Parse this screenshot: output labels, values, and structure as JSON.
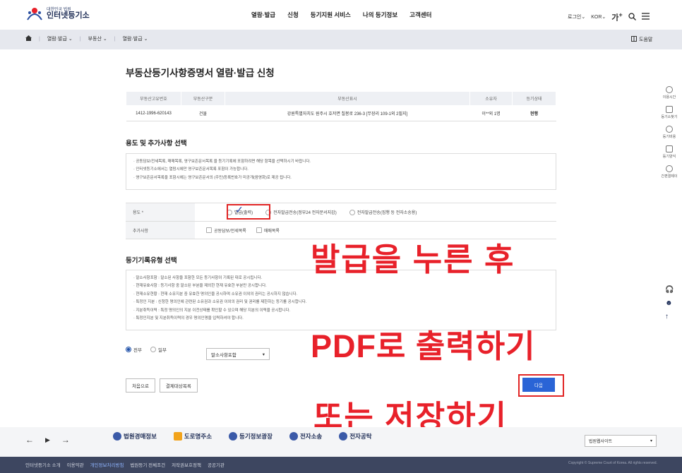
{
  "header": {
    "logo_small": "대한민국 법원",
    "logo_name": "인터넷등기소",
    "nav": [
      "열람·발급",
      "신청",
      "등기지원 서비스",
      "나의 등기정보",
      "고객센터"
    ],
    "login": "로그인",
    "lang": "KOR",
    "font_size": "가",
    "font_plus": "+"
  },
  "breadcrumb": {
    "items": [
      "열람·발급",
      "부동산",
      "열람·발급"
    ],
    "help": "도움말"
  },
  "page_title": "부동산등기사항증명서 열람·발급 신청",
  "property_table": {
    "headers": [
      "부동산고유번호",
      "부동산구분",
      "부동산표시",
      "소유자",
      "등기상태"
    ],
    "row": [
      "1412-1996-620143",
      "건물",
      "강원특별자치도 원주시 호저면 칠봉로 236-3 [무장리 109-1외 2필지]",
      "이**외 1명",
      "현행"
    ]
  },
  "usage_section": {
    "title": "용도 및 추가사항 선택",
    "notes": [
      "공동담보/전세목록, 매매목록, 영구보존문서목록 을 등기기록에 포함하려면 해당 항목을 선택하시기 바랍니다.",
      "인터넷등기소에서는 열람시에만 영구보존문서목록 포함이 가능합니다.",
      "영구보존문서목록을 포함시에는 영구보존문서의 (주민)등록번호가 미공개(음영화)로 제공 됩니다."
    ],
    "usage_label": "용도 *",
    "usage_options": [
      "발급(출력)",
      "전자발급전송(정부24 전자문서지갑)",
      "전자발급전송(집행 등 전자소송용)"
    ],
    "extra_label": "추가사항",
    "extra_options": [
      "공동담보/전세목록",
      "매매목록"
    ]
  },
  "record_section": {
    "title": "등기기록유형 선택",
    "notes": [
      "말소사항포함 : 말소된 사항을 포함한 모든 등기사항이 기록된 대로 공시됩니다.",
      "현재유효사항 : 등기사항 중 말소된 부분을 제외한 현재 유효한 부분만 공시합니다.",
      "현재소유현황 : 현재 소유지분 중 유효한 명의인을 공시하며 소유권 이외의 권리는 공시하지 않습니다.",
      "특정인 지분 : 신청한 명의인에 관련된 소유권과 소유권 이외의 권리 및 권리를 제한하는 등기를 공시합니다.",
      "지분취득이력 : 특정 명의인의 지분 이전상태를 확인할 수 있으며 해당 지분의 이력을 공시합니다.",
      "특정인지분 및 지분취득이력의 경우 명의인명을 입력하셔야 합니다."
    ],
    "scope_all": "전부",
    "scope_part": "일부",
    "record_type": "말소사항포함"
  },
  "buttons": {
    "first": "처음으로",
    "payment_list": "결제대상목록",
    "next": "다음"
  },
  "overlay": {
    "line1": "발급을 누른 후",
    "line2": "PDF로 출력하기",
    "line3": "또는 저장하기"
  },
  "quick_menu": [
    "이용시간",
    "등기소찾기",
    "등기비용",
    "등기양식",
    "간편결제이"
  ],
  "footer": {
    "banners": [
      "법원경매정보",
      "도로명주소",
      "등기정보광장",
      "전자소송",
      "전자공탁"
    ],
    "family_site": "법원웹사이트",
    "links": [
      "인터넷등기소 소개",
      "이용약관",
      "개인정보처리방침",
      "법원등기 전체조건",
      "저작권보호정책",
      "공공기관"
    ],
    "copyright": "Copyright © Supreme Court of Korea. All rights reserved."
  },
  "colors": {
    "accent": "#2a64d6",
    "overlay_red": "#e8212a",
    "status_blue": "#1a5fc0"
  }
}
